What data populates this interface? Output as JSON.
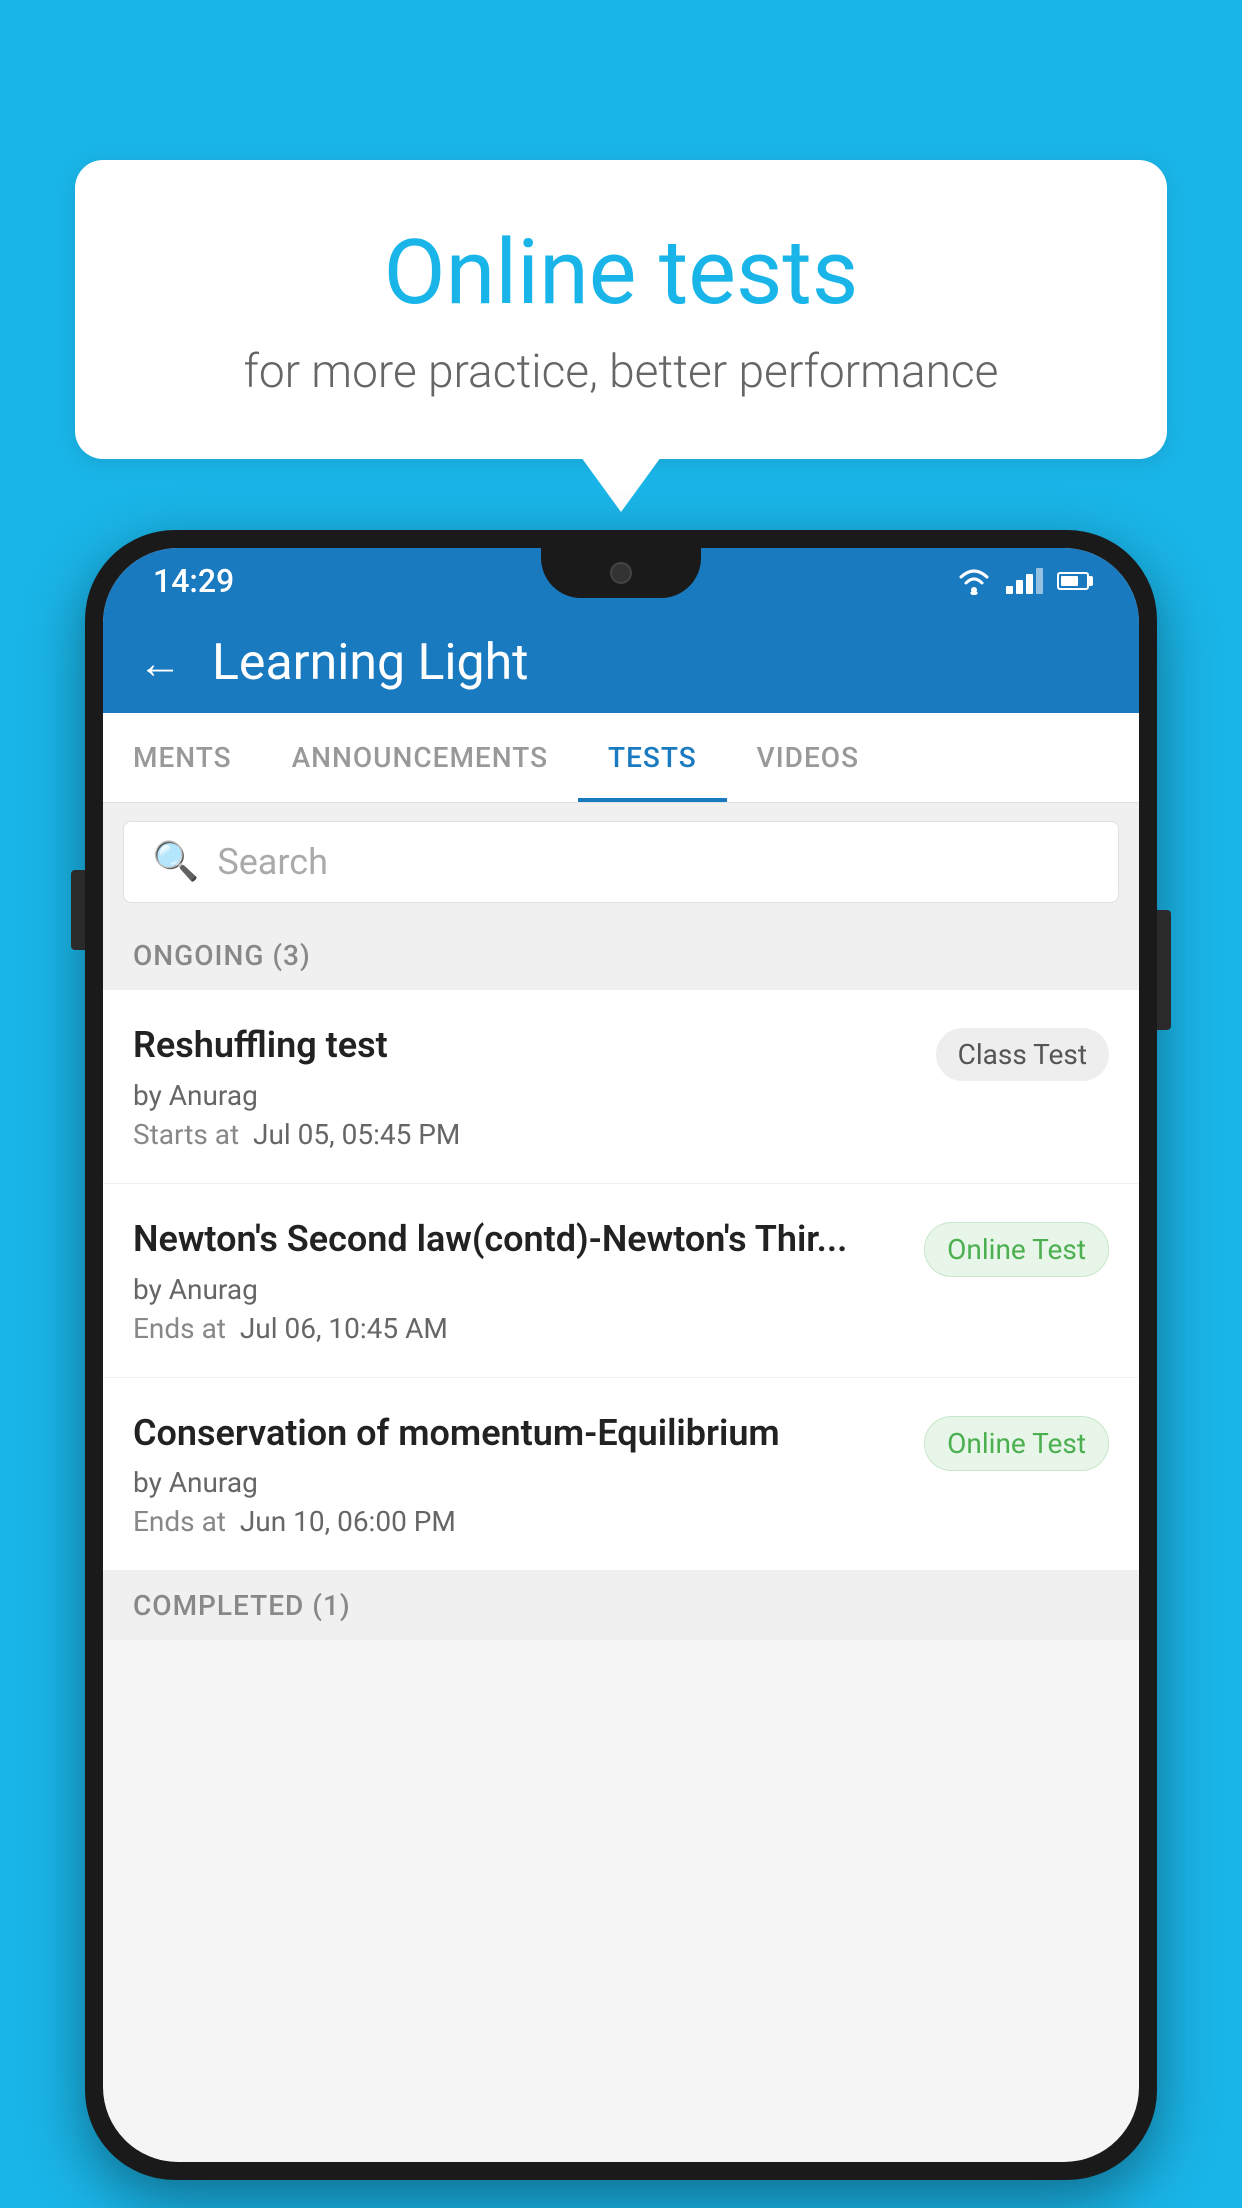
{
  "background": {
    "color": "#1ab5e8"
  },
  "speech_bubble": {
    "title": "Online tests",
    "subtitle": "for more practice, better performance"
  },
  "phone": {
    "status_bar": {
      "time": "14:29",
      "icons": [
        "wifi",
        "signal",
        "battery"
      ]
    },
    "app_header": {
      "back_label": "←",
      "title": "Learning Light"
    },
    "tabs": [
      {
        "label": "MENTS",
        "active": false
      },
      {
        "label": "ANNOUNCEMENTS",
        "active": false
      },
      {
        "label": "TESTS",
        "active": true
      },
      {
        "label": "VIDEOS",
        "active": false
      }
    ],
    "search": {
      "placeholder": "Search"
    },
    "section_ongoing": {
      "label": "ONGOING (3)"
    },
    "tests": [
      {
        "name": "Reshuffling test",
        "author": "by Anurag",
        "time_label": "Starts at",
        "time": "Jul 05, 05:45 PM",
        "badge": "Class Test",
        "badge_type": "class"
      },
      {
        "name": "Newton's Second law(contd)-Newton's Thir...",
        "author": "by Anurag",
        "time_label": "Ends at",
        "time": "Jul 06, 10:45 AM",
        "badge": "Online Test",
        "badge_type": "online"
      },
      {
        "name": "Conservation of momentum-Equilibrium",
        "author": "by Anurag",
        "time_label": "Ends at",
        "time": "Jun 10, 06:00 PM",
        "badge": "Online Test",
        "badge_type": "online"
      }
    ],
    "section_completed": {
      "label": "COMPLETED (1)"
    }
  }
}
